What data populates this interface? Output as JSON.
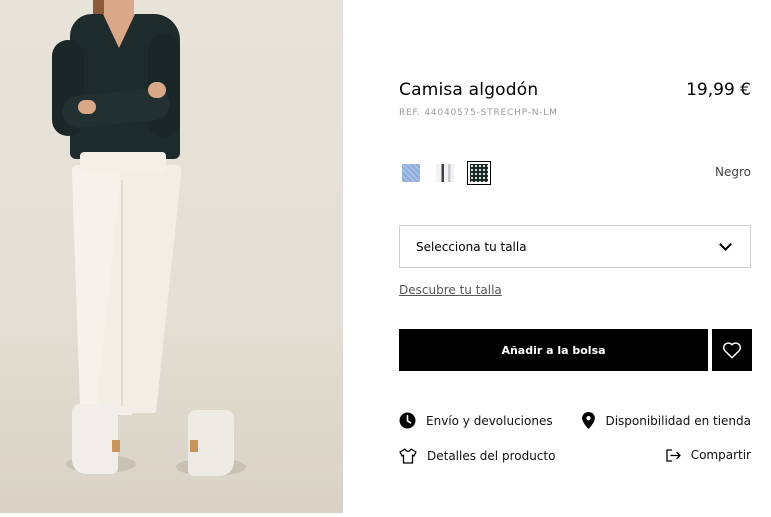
{
  "product": {
    "title": "Camisa algodón",
    "price": "19,99 €",
    "reference": "REF. 44040575-STRECHP-N-LM"
  },
  "colors": {
    "selected_name": "Negro",
    "swatches": [
      {
        "name": "blue-pattern-swatch",
        "color": "#a9c1e6"
      },
      {
        "name": "stripe-swatch",
        "color": "#3a3f4a"
      },
      {
        "name": "black-dots-swatch",
        "color": "#1b2a28"
      }
    ]
  },
  "size": {
    "select_label": "Selecciona tu talla",
    "guide_link": "Descubre tu talla"
  },
  "actions": {
    "add_to_bag": "Añadir a la bolsa"
  },
  "info_links": {
    "shipping": "Envío y devoluciones",
    "store_availability": "Disponibilidad en tienda",
    "product_details": "Detalles del producto",
    "share": "Compartir"
  },
  "icons": {
    "shipping": "clock-icon",
    "store": "location-pin-icon",
    "details": "shirt-icon",
    "share": "share-arrow-icon",
    "wishlist": "heart-icon",
    "dropdown": "chevron-down-icon"
  }
}
